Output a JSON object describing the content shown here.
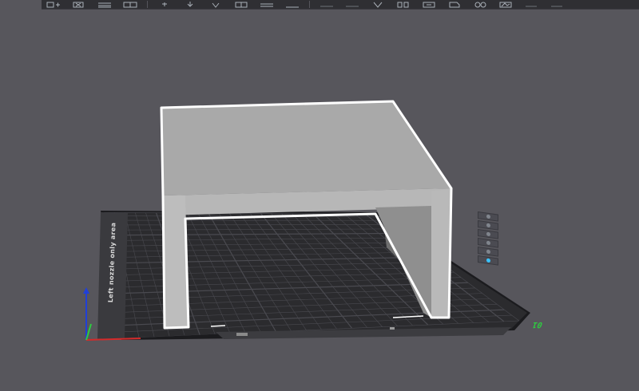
{
  "toolbar": {
    "icons": [
      "add-model-icon",
      "delete-icon",
      "align-icon",
      "arrange-icon",
      "flatten-icon",
      "move-down-icon",
      "rotate-icon",
      "scale-icon",
      "cut-icon",
      "support-icon",
      "seam-icon",
      "split-icon",
      "measure-icon",
      "assembly-icon",
      "paint-icon",
      "brim-icon",
      "text-icon",
      "cut-tool-icon",
      "undo-icon",
      "redo-icon"
    ]
  },
  "plate": {
    "side_label": "Left nozzle only area",
    "number": "01",
    "colors": {
      "bed": "#2b2b2e",
      "grid": "#4a4a50",
      "border": "#111113",
      "axis_x": "#d42a2a",
      "axis_y": "#2ecc40",
      "axis_z": "#2040d8",
      "plate_number": "#2ecc40"
    }
  },
  "model": {
    "name": "table-model",
    "selected": true,
    "colors": {
      "top": "#a9a9a9",
      "front": "#b9b9b9",
      "side": "#8e8e8e",
      "outline": "#ffffff"
    }
  },
  "side_tools": {
    "icons": [
      "view-top-icon",
      "view-front-icon",
      "view-iso-icon",
      "view-fit-icon",
      "view-grid-icon",
      "view-active-icon"
    ],
    "active_index": 5,
    "active_color": "#39c2ff"
  }
}
